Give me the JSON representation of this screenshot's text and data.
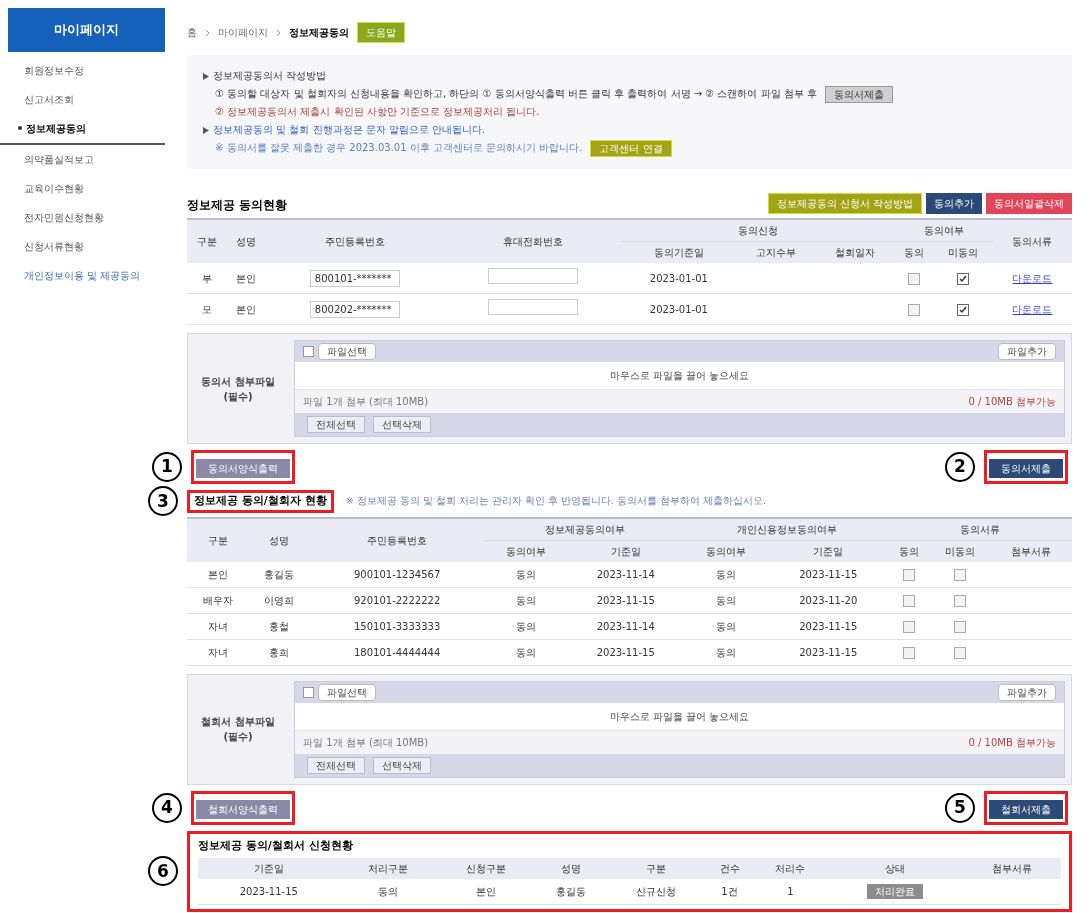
{
  "sidebar": {
    "title": "마이페이지",
    "items": [
      {
        "label": "회원정보수정",
        "selected": false
      },
      {
        "label": "신고서조회",
        "selected": false
      },
      {
        "label": "정보제공동의",
        "selected": true
      },
      {
        "label": "의약품실적보고",
        "selected": false
      },
      {
        "label": "교육이수현황",
        "selected": false
      },
      {
        "label": "전자민원신청현황",
        "selected": false
      },
      {
        "label": "신청서류현황",
        "selected": false
      },
      {
        "label": "개인정보이용 및 제공동의",
        "selected": false,
        "kind": "link"
      }
    ]
  },
  "breadcrumb": {
    "items": [
      "홈",
      "마이페이지",
      "정보제공동의"
    ],
    "badge": "도움말"
  },
  "info": {
    "heading": "정보제공동의서 작성방법",
    "step1": {
      "text": "① 동의할 대상자 및 철회자의 신청내용을 확인하고, 하단의 ① 동의서양식출력 버튼 클릭 후 출력하여 서명 → ② 스캔하여 파일 첨부 후",
      "button": "동의서제출"
    },
    "step2": "② 정보제공동의서 제출시 확인된 사항만 기준으로 정보제공처리 됩니다.",
    "notice": "정보제공동의 및 철회 진행과정은 문자 알림으로 안내됩니다.",
    "warning": {
      "text": "※ 동의서를 잘못 제출한 경우 2023.03.01 이후 고객센터로 문의하시기 바랍니다.",
      "button": "고객센터 연결"
    }
  },
  "section1": {
    "title": "정보제공 동의현황",
    "buttons": [
      {
        "label": "정보제공동의 신청서 작성방법",
        "kind": "olive"
      },
      {
        "label": "동의추가",
        "kind": "navy"
      },
      {
        "label": "동의서일괄삭제",
        "kind": "red"
      }
    ],
    "header_rows": [
      [
        {
          "label": "구분",
          "rowspan": 2
        },
        {
          "label": "성명",
          "rowspan": 2
        },
        {
          "label": "주민등록번호",
          "rowspan": 2
        },
        {
          "label": "휴대전화번호",
          "rowspan": 2
        },
        {
          "label": "동의신청",
          "colspan": 3
        },
        {
          "label": "동의여부",
          "colspan": 2
        },
        {
          "label": "동의서류",
          "rowspan": 2
        }
      ],
      [
        {
          "label": "동의기준일"
        },
        {
          "label": "고지수부"
        },
        {
          "label": "철회일자"
        },
        {
          "label": "동의"
        },
        {
          "label": "미동의"
        }
      ]
    ],
    "rows": [
      [
        {
          "kind": "text",
          "text": "부"
        },
        {
          "kind": "text",
          "text": "본인"
        },
        {
          "kind": "field",
          "text": "800101-*******"
        },
        {
          "kind": "field"
        },
        {
          "kind": "text",
          "text": "2023-01-01"
        },
        {
          "kind": "empty"
        },
        {
          "kind": "empty"
        },
        {
          "kind": "check",
          "checked": false
        },
        {
          "kind": "check",
          "checked": true
        },
        {
          "kind": "link",
          "text": "다운로드"
        }
      ],
      [
        {
          "kind": "text",
          "text": "모"
        },
        {
          "kind": "text",
          "text": "본인"
        },
        {
          "kind": "field",
          "text": "800202-*******"
        },
        {
          "kind": "field"
        },
        {
          "kind": "text",
          "text": "2023-01-01"
        },
        {
          "kind": "empty"
        },
        {
          "kind": "empty"
        },
        {
          "kind": "check",
          "checked": false
        },
        {
          "kind": "check",
          "checked": true
        },
        {
          "kind": "link",
          "text": "다운로드"
        }
      ]
    ],
    "upload": {
      "label": "동의서 첨부파일 (필수)",
      "select": {
        "label": "파일선택",
        "checked": false
      },
      "add": "파일추가",
      "drop": "마우스로 파일을 끌어 놓으세요",
      "file": "파일 1개 첨부 (최대 10MB)",
      "capacity": "0 / 10MB 첨부가능",
      "buttons": [
        "전체선택",
        "선택삭제"
      ]
    },
    "print_button": {
      "label": "동의서양식출력",
      "marker": "1"
    },
    "submit_button": {
      "label": "동의서제출",
      "marker": "2"
    }
  },
  "section2": {
    "title": "정보제공 동의/철회자 현황",
    "marker": "3",
    "note": "※ 정보제공 동의 및 철회 처리는 관리자 확인 후 반영됩니다. 동의서를 첨부하여 제출하십시오.",
    "header_rows": [
      [
        {
          "label": "구분",
          "rowspan": 2
        },
        {
          "label": "성명",
          "rowspan": 2
        },
        {
          "label": "주민등록번호",
          "rowspan": 2
        },
        {
          "label": "정보제공동의여부",
          "colspan": 2
        },
        {
          "label": "개인신용정보동의여부",
          "colspan": 2
        },
        {
          "label": "동의서류",
          "colspan": 3
        }
      ],
      [
        {
          "label": "동의여부"
        },
        {
          "label": "기준일"
        },
        {
          "label": "동의여부"
        },
        {
          "label": "기준일"
        },
        {
          "label": "동의"
        },
        {
          "label": "미동의"
        },
        {
          "label": "첨부서류"
        }
      ]
    ],
    "rows": [
      [
        {
          "kind": "text",
          "text": "본인"
        },
        {
          "kind": "text",
          "text": "홍길동"
        },
        {
          "kind": "text",
          "text": "900101-1234567"
        },
        {
          "kind": "text",
          "text": "동의"
        },
        {
          "kind": "text",
          "text": "2023-11-14"
        },
        {
          "kind": "text",
          "text": "동의"
        },
        {
          "kind": "text",
          "text": "2023-11-15"
        },
        {
          "kind": "check",
          "checked": false
        },
        {
          "kind": "check",
          "checked": false
        },
        {
          "kind": "empty"
        }
      ],
      [
        {
          "kind": "text",
          "text": "배우자"
        },
        {
          "kind": "text",
          "text": "이영희"
        },
        {
          "kind": "text",
          "text": "920101-2222222"
        },
        {
          "kind": "text",
          "text": "동의"
        },
        {
          "kind": "text",
          "text": "2023-11-15"
        },
        {
          "kind": "text",
          "text": "동의"
        },
        {
          "kind": "text",
          "text": "2023-11-20"
        },
        {
          "kind": "check",
          "checked": false
        },
        {
          "kind": "check",
          "checked": false
        },
        {
          "kind": "empty"
        }
      ],
      [
        {
          "kind": "text",
          "text": "자녀"
        },
        {
          "kind": "text",
          "text": "홍철"
        },
        {
          "kind": "text",
          "text": "150101-3333333"
        },
        {
          "kind": "text",
          "text": "동의"
        },
        {
          "kind": "text",
          "text": "2023-11-14"
        },
        {
          "kind": "text",
          "text": "동의"
        },
        {
          "kind": "text",
          "text": "2023-11-15"
        },
        {
          "kind": "check",
          "checked": false
        },
        {
          "kind": "check",
          "checked": false
        },
        {
          "kind": "empty"
        }
      ],
      [
        {
          "kind": "text",
          "text": "자녀"
        },
        {
          "kind": "text",
          "text": "홍희"
        },
        {
          "kind": "text",
          "text": "180101-4444444"
        },
        {
          "kind": "text",
          "text": "동의"
        },
        {
          "kind": "text",
          "text": "2023-11-15"
        },
        {
          "kind": "text",
          "text": "동의"
        },
        {
          "kind": "text",
          "text": "2023-11-15"
        },
        {
          "kind": "check",
          "checked": false
        },
        {
          "kind": "check",
          "checked": false
        },
        {
          "kind": "empty"
        }
      ]
    ],
    "upload": {
      "label": "철회서 첨부파일 (필수)",
      "select": {
        "label": "파일선택",
        "checked": false
      },
      "add": "파일추가",
      "drop": "마우스로 파일을 끌어 놓으세요",
      "file": "파일 1개 첨부 (최대 10MB)",
      "capacity": "0 / 10MB 첨부가능",
      "buttons": [
        "전체선택",
        "선택삭제"
      ]
    },
    "print_button": {
      "label": "철회서양식출력",
      "marker": "4"
    },
    "submit_button": {
      "label": "철회서제출",
      "marker": "5"
    }
  },
  "section3": {
    "title": "정보제공 동의/철회서 신청현황",
    "marker": "6",
    "header_rows": [
      [
        {
          "label": "기준일"
        },
        {
          "label": "처리구분"
        },
        {
          "label": "신청구분"
        },
        {
          "label": "성명"
        },
        {
          "label": "구분"
        },
        {
          "label": "건수"
        },
        {
          "label": "처리수"
        },
        {
          "label": "상태"
        },
        {
          "label": "첨부서류"
        }
      ]
    ],
    "rows": [
      [
        {
          "kind": "text",
          "text": "2023-11-15"
        },
        {
          "kind": "text",
          "text": "동의"
        },
        {
          "kind": "text",
          "text": "본인"
        },
        {
          "kind": "text",
          "text": "홍길동"
        },
        {
          "kind": "text",
          "text": "신규신청"
        },
        {
          "kind": "text",
          "text": "1건"
        },
        {
          "kind": "text",
          "text": "1"
        },
        {
          "kind": "badge",
          "text": "처리완료"
        },
        {
          "kind": "empty"
        }
      ]
    ]
  }
}
